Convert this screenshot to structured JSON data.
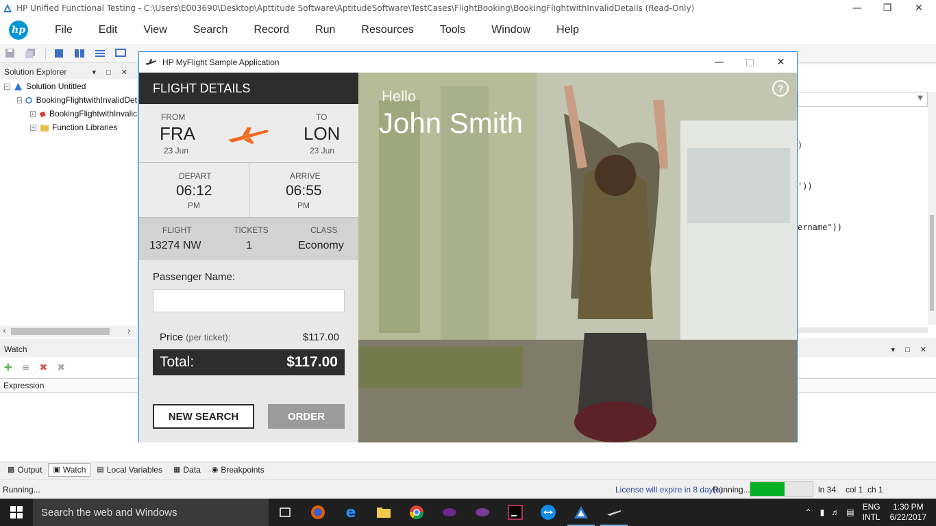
{
  "window": {
    "title": "HP Unified Functional Testing - C:\\Users\\E003690\\Desktop\\Apttitude Software\\AptitudeSoftware\\TestCases\\FlightBooking\\BookingFlightwithInvalidDetails (Read-Only)"
  },
  "menubar": {
    "logo": "hp",
    "items": [
      "File",
      "Edit",
      "View",
      "Search",
      "Record",
      "Run",
      "Resources",
      "Tools",
      "Window",
      "Help"
    ]
  },
  "solution_explorer": {
    "title": "Solution Explorer",
    "items": [
      {
        "label": "Solution Untitled",
        "icon": "solution-icon"
      },
      {
        "label": "BookingFlightwithInvalidDet",
        "icon": "test-icon"
      },
      {
        "label": "BookingFlightwithInvalic",
        "icon": "action-icon"
      },
      {
        "label": "Function Libraries",
        "icon": "folder-icon"
      }
    ]
  },
  "watch": {
    "title": "Watch",
    "column_header": "Expression"
  },
  "editor": {
    "fragments": [
      ")",
      "'))",
      "ername\"))"
    ]
  },
  "bottom_tabs": [
    "Output",
    "Watch",
    "Local Variables",
    "Data",
    "Breakpoints"
  ],
  "statusbar": {
    "left": "Running...",
    "license": "License will expire in 8 day(s)",
    "running": "Running...",
    "progress_fraction": 0.55,
    "line": "ln 34",
    "col": "col 1",
    "ch": "ch 1"
  },
  "taskbar": {
    "search": "Search the web and Windows",
    "lang_top": "ENG",
    "lang_bottom": "INTL",
    "time": "1:30 PM",
    "date": "6/22/2017"
  },
  "myflight": {
    "title": "HP MyFlight Sample Application",
    "header": "FLIGHT DETAILS",
    "from_label": "FROM",
    "from_code": "FRA",
    "from_date": "23 Jun",
    "to_label": "TO",
    "to_code": "LON",
    "to_date": "23 Jun",
    "depart_label": "DEPART",
    "depart_time": "06:12",
    "depart_ampm": "PM",
    "arrive_label": "ARRIVE",
    "arrive_time": "06:55",
    "arrive_ampm": "PM",
    "flight_label": "FLIGHT",
    "flight_value": "13274 NW",
    "tickets_label": "TICKETS",
    "tickets_value": "1",
    "class_label": "CLASS",
    "class_value": "Economy",
    "passenger_label": "Passenger Name:",
    "passenger_value": "",
    "price_label": "Price",
    "price_per": "(per ticket):",
    "price_value": "$117.00",
    "total_label": "Total:",
    "total_value": "$117.00",
    "new_search": "NEW SEARCH",
    "order": "ORDER",
    "hello": "Hello",
    "user_name": "John Smith",
    "help": "?",
    "accent_color": "#f26b21"
  }
}
